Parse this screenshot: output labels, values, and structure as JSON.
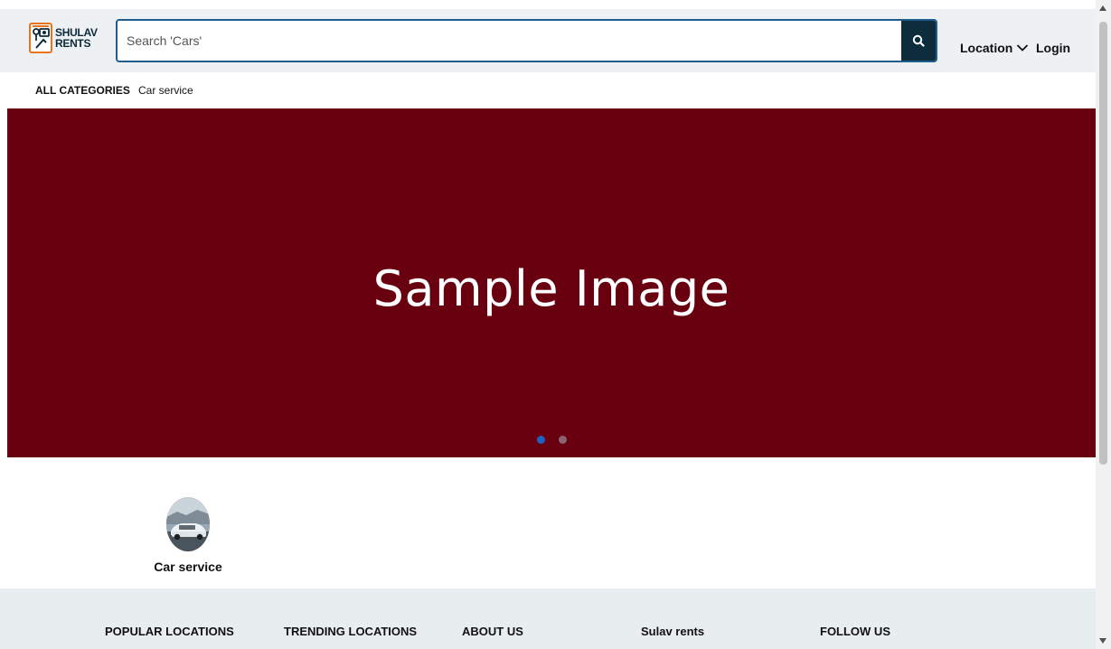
{
  "header": {
    "logo_line1": "SHULAV",
    "logo_line2": "RENTS",
    "search_placeholder": "Search 'Cars'",
    "search_icon": "search-icon",
    "location_label": "Location",
    "location_icon": "chevron-down-icon",
    "login_label": "Login"
  },
  "category_bar": {
    "all_label": "ALL CATEGORIES",
    "items": [
      {
        "label": "Car service"
      }
    ]
  },
  "hero": {
    "caption": "Sample Image",
    "background": "#690010",
    "slides": 2,
    "active_slide": 1,
    "dot_active_color": "#1f63c0",
    "dot_inactive_color": "#8a6670"
  },
  "categories": [
    {
      "label": "Car service",
      "icon": "car-avatar"
    }
  ],
  "footer": {
    "columns": [
      {
        "label": "POPULAR LOCATIONS"
      },
      {
        "label": "TRENDING LOCATIONS"
      },
      {
        "label": "ABOUT US"
      },
      {
        "label": "Sulav rents"
      },
      {
        "label": "FOLLOW US"
      }
    ]
  },
  "colors": {
    "brand_orange": "#e8731f",
    "brand_navy": "#0d2d3d",
    "search_border": "#1f5d8c"
  }
}
